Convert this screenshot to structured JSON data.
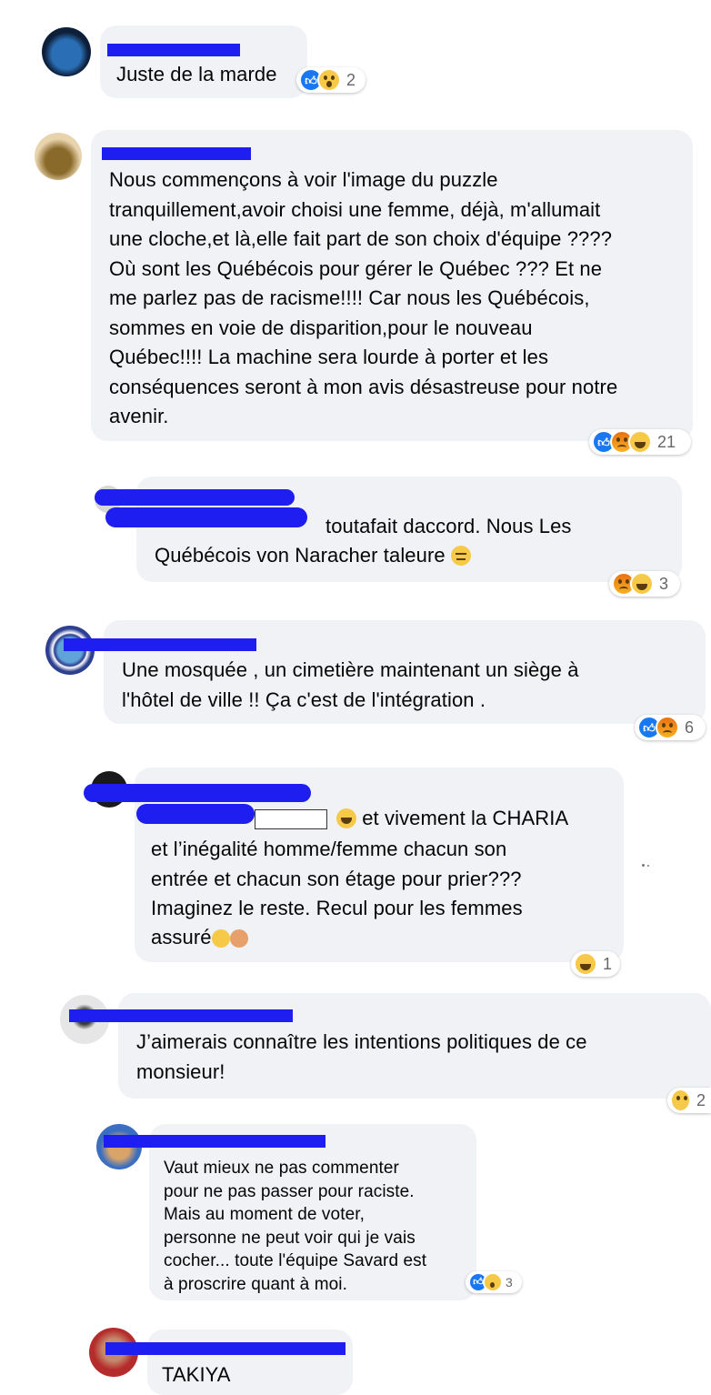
{
  "comments": [
    {
      "id": "c1",
      "text": "Juste de la marde",
      "reactions": [
        "like",
        "wow"
      ],
      "count": "2"
    },
    {
      "id": "c2",
      "text": "Nous commençons à voir l'image du puzzle\ntranquillement,avoir choisi une femme, déjà, m'allumait\nune cloche,et là,elle fait part de son choix d'équipe ????\nOù sont les Québécois pour gérer le Québec ??? Et ne\nme parlez pas de racisme!!!! Car nous les Québécois,\nsommes en voie de disparition,pour le nouveau\nQuébec!!!! La machine sera lourde à porter et les\nconséquences seront à mon avis désastreuse pour notre\navenir.",
      "reactions": [
        "like",
        "angry",
        "haha"
      ],
      "count": "21"
    },
    {
      "id": "c3",
      "text_line1": "toutafait daccord. Nous Les",
      "text_line2": "Québécois von Naracher taleure",
      "reactions": [
        "angry",
        "haha"
      ],
      "count": "3"
    },
    {
      "id": "c4",
      "text": "Une mosquée , un cimetière maintenant un siège à\nl'hôtel de ville !! Ça c'est de l'intégration .",
      "reactions": [
        "like",
        "angry"
      ],
      "count": "6"
    },
    {
      "id": "c5",
      "text_line1": "et vivement la CHARIA",
      "text_rest": "et l’inégalité homme/femme chacun son\nentrée et chacun son étage pour prier???\nImaginez le reste. Recul pour les femmes",
      "text_last": "assuré",
      "reactions": [
        "haha"
      ],
      "count": "1"
    },
    {
      "id": "c6",
      "text": "J’aimerais connaître les intentions politiques de ce\nmonsieur!",
      "reactions": [
        "care"
      ],
      "count": "2"
    },
    {
      "id": "c7",
      "text": "Vaut mieux ne pas commenter\npour ne pas passer pour raciste.\nMais au moment de voter,\npersonne ne peut voir qui je vais\ncocher... toute l'équipe Savard est\nà proscrire quant à moi.",
      "reactions": [
        "like",
        "wow"
      ],
      "count": "3"
    },
    {
      "id": "c8",
      "text": "TAKIYA"
    }
  ],
  "colors": {
    "bubble": "#f0f2f5",
    "redaction": "#1e1ef0",
    "like": "#1877f2",
    "angry": "#e9710f",
    "emoji": "#f7c948"
  }
}
